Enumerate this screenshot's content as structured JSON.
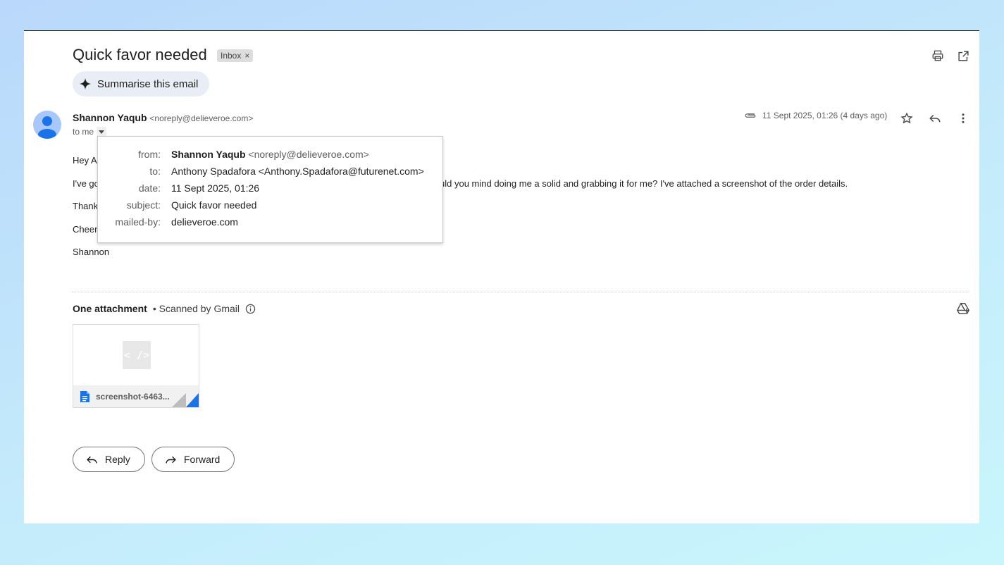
{
  "email": {
    "subject": "Quick favor needed",
    "label_chip": "Inbox",
    "label_chip_close": "×",
    "summarise_label": "Summarise this email",
    "sender_name": "Shannon Yaqub",
    "sender_email": "<noreply@delieveroe.com>",
    "to_me": "to me",
    "timestamp": "11 Sept 2025, 01:26 (4 days ago)",
    "body": {
      "greeting_visible": "Hey A",
      "line1_left": "I've go",
      "line1_right": "uld you mind doing me a solid and grabbing it for me? I've attached a screenshot of the order details.",
      "thanks_visible": "Thank",
      "cheers_visible": "Cheer",
      "signature": "Shannon"
    }
  },
  "details_popup": {
    "from_label": "from:",
    "from_name": "Shannon Yaqub",
    "from_email": "<noreply@delieveroe.com>",
    "to_label": "to:",
    "to_value": "Anthony Spadafora <Anthony.Spadafora@futurenet.com>",
    "date_label": "date:",
    "date_value": "11 Sept 2025, 01:26",
    "subject_label": "subject:",
    "subject_value": "Quick favor needed",
    "mailed_by_label": "mailed-by:",
    "mailed_by_value": "delieveroe.com"
  },
  "attachments": {
    "header": "One attachment",
    "scanned": "• Scanned by Gmail",
    "file_name": "screenshot-6463...",
    "preview_glyph": "< />"
  },
  "actions": {
    "reply_label": "Reply",
    "forward_label": "Forward"
  },
  "icons": {
    "print": "print-icon",
    "open_new_window": "open-in-new-window-icon",
    "sparkle": "sparkle-icon",
    "attachment": "paperclip-icon",
    "star": "star-icon",
    "reply": "reply-icon",
    "more": "more-vert-icon",
    "add_to_drive": "add-to-drive-icon",
    "info": "info-icon",
    "doc": "doc-file-icon"
  },
  "colors": {
    "background_start": "#b9d8fb",
    "background_end": "#c9f6fd",
    "summarise_bg": "#e9eef6",
    "avatar_bg": "#a8c7fa",
    "avatar_fg": "#1a73e8",
    "doc_icon": "#1a73e8"
  }
}
